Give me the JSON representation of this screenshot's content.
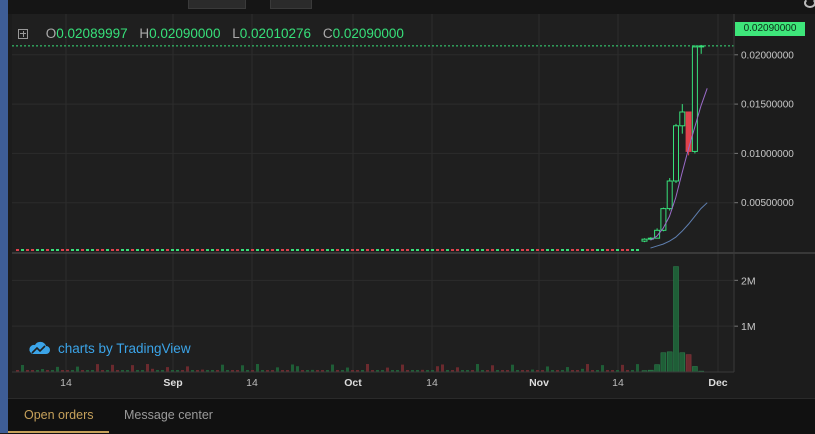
{
  "ohlc": {
    "open_label": "O",
    "open": "0.02089997",
    "high_label": "H",
    "high": "0.02090000",
    "low_label": "L",
    "low": "0.02010276",
    "close_label": "C",
    "close": "0.02090000"
  },
  "last_price_tag": "0.02090000",
  "brand": {
    "text": "charts by TradingView",
    "icon": "cloud-icon"
  },
  "tabs": [
    {
      "label": "Open orders",
      "active": true
    },
    {
      "label": "Message center",
      "active": false
    }
  ],
  "colors": {
    "up": "#37e07a",
    "down": "#e0424d",
    "price_tag": "#3ee67a",
    "tab_active": "#c6a15b",
    "brand": "#3ba4e8"
  },
  "chart_data": {
    "type": "candlestick",
    "price_axis": {
      "ticks": [
        "0.02000000",
        "0.01500000",
        "0.01000000",
        "0.00500000"
      ],
      "tick_values": [
        0.02,
        0.015,
        0.01,
        0.005
      ],
      "range": [
        0,
        0.0215
      ]
    },
    "volume_axis": {
      "ticks": [
        "2M",
        "1M"
      ],
      "tick_values": [
        2000000,
        1000000
      ],
      "range": [
        0,
        2400000
      ]
    },
    "time_axis": {
      "ticks": [
        "14",
        "Sep",
        "14",
        "Oct",
        "14",
        "Nov",
        "14",
        "Dec"
      ]
    },
    "last_price": 0.0209,
    "candles": [
      {
        "o": 0.0011,
        "h": 0.0014,
        "l": 0.001,
        "c": 0.0013,
        "v": 30000
      },
      {
        "o": 0.0013,
        "h": 0.0015,
        "l": 0.0012,
        "c": 0.0014,
        "v": 40000
      },
      {
        "o": 0.0014,
        "h": 0.0024,
        "l": 0.0014,
        "c": 0.0022,
        "v": 160000
      },
      {
        "o": 0.0022,
        "h": 0.0045,
        "l": 0.0021,
        "c": 0.0044,
        "v": 420000
      },
      {
        "o": 0.0044,
        "h": 0.0075,
        "l": 0.0042,
        "c": 0.0072,
        "v": 440000
      },
      {
        "o": 0.0072,
        "h": 0.013,
        "l": 0.007,
        "c": 0.0128,
        "v": 2300000
      },
      {
        "o": 0.0128,
        "h": 0.015,
        "l": 0.012,
        "c": 0.0142,
        "v": 420000
      },
      {
        "o": 0.0142,
        "h": 0.0142,
        "l": 0.0098,
        "c": 0.0102,
        "v": 380000
      },
      {
        "o": 0.0102,
        "h": 0.021,
        "l": 0.01,
        "c": 0.0208,
        "v": 120000
      },
      {
        "o": 0.0208,
        "h": 0.021,
        "l": 0.0201,
        "c": 0.0209,
        "v": 20000
      }
    ],
    "ma_fast": [
      0.0012,
      0.0016,
      0.0024,
      0.0036,
      0.0055,
      0.008,
      0.0104,
      0.0126,
      0.0148,
      0.0166
    ],
    "ma_slow": [
      0.0004,
      0.0006,
      0.0008,
      0.0011,
      0.0015,
      0.0021,
      0.0028,
      0.0036,
      0.0044,
      0.005
    ]
  }
}
